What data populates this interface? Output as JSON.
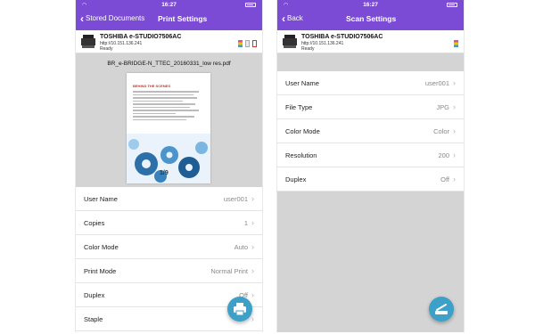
{
  "status": {
    "time": "16:27"
  },
  "colors": {
    "header": "#7b4bd6",
    "fab": "#3ca0c8",
    "toner": [
      "#e84c8a",
      "#f2c200",
      "#3a9ad9",
      "#222222"
    ]
  },
  "device": {
    "name": "TOSHIBA e-STUDIO7506AC",
    "ip": "http://10.151.136.241",
    "status": "Ready"
  },
  "print_screen": {
    "back_label": "Stored Documents",
    "title": "Print Settings",
    "document_name": "BR_e-BRIDGE-N_TTEC_20160331_low res.pdf",
    "page_heading": "BEHIND THE SCENES",
    "page_indicator": "1/9",
    "settings": [
      {
        "label": "User Name",
        "value": "user001"
      },
      {
        "label": "Copies",
        "value": "1"
      },
      {
        "label": "Color Mode",
        "value": "Auto"
      },
      {
        "label": "Print Mode",
        "value": "Normal Print"
      },
      {
        "label": "Duplex",
        "value": "Off"
      },
      {
        "label": "Staple",
        "value": ""
      }
    ],
    "fab_icon": "printer-icon"
  },
  "scan_screen": {
    "back_label": "Back",
    "title": "Scan Settings",
    "settings": [
      {
        "label": "User Name",
        "value": "user001"
      },
      {
        "label": "File Type",
        "value": "JPG"
      },
      {
        "label": "Color Mode",
        "value": "Color"
      },
      {
        "label": "Resolution",
        "value": "200"
      },
      {
        "label": "Duplex",
        "value": "Off"
      }
    ],
    "fab_icon": "scanner-icon"
  }
}
